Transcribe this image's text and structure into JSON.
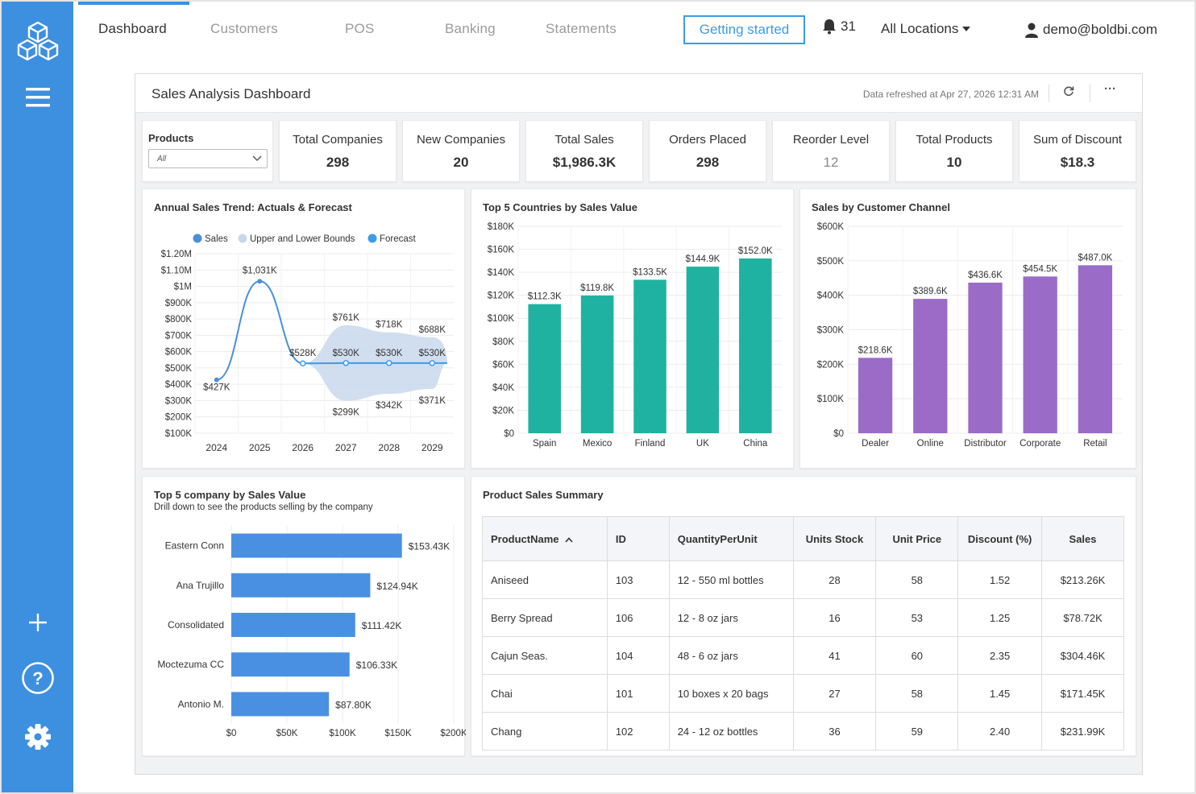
{
  "nav": {
    "tabs": [
      "Dashboard",
      "Customers",
      "POS",
      "Banking",
      "Statements"
    ],
    "getting_started": "Getting started",
    "notifications": "31",
    "location": "All Locations",
    "user": "demo@boldbi.com"
  },
  "sidebar": {
    "icons": [
      "logo-cube-icon",
      "menu-icon",
      "plus-icon",
      "help-icon",
      "settings-icon"
    ]
  },
  "dashboard": {
    "title": "Sales Analysis Dashboard",
    "refreshed": "Data refreshed at Apr 27, 2026 12:31 AM"
  },
  "filter": {
    "label": "Products",
    "value": "All"
  },
  "kpis": [
    {
      "label": "Total Companies",
      "value": "298"
    },
    {
      "label": "New Companies",
      "value": "20"
    },
    {
      "label": "Total Sales",
      "value": "$1,986.3K"
    },
    {
      "label": "Orders Placed",
      "value": "298"
    },
    {
      "label": "Reorder Level",
      "value": "12"
    },
    {
      "label": "Total Products",
      "value": "10"
    },
    {
      "label": "Sum of Discount",
      "value": "$18.3"
    }
  ],
  "chart_data": [
    {
      "type": "line",
      "title": "Annual Sales Trend: Actuals & Forecast",
      "legend": [
        "Sales",
        "Upper and Lower Bounds",
        "Forecast"
      ],
      "legend_position": "top",
      "x": [
        "2024",
        "2025",
        "2026",
        "2027",
        "2028",
        "2029"
      ],
      "series": [
        {
          "name": "Sales",
          "x": [
            "2024",
            "2025",
            "2026"
          ],
          "values": [
            427,
            1031,
            528
          ],
          "labels": [
            "$427K",
            "$1,031K",
            "$528K"
          ]
        },
        {
          "name": "Forecast",
          "x": [
            "2026",
            "2027",
            "2028",
            "2029"
          ],
          "values": [
            528,
            530,
            530,
            530
          ],
          "labels": [
            "$528K",
            "$530K",
            "$530K",
            "$530K"
          ]
        },
        {
          "name": "Upper and Lower Bounds",
          "x": [
            "2027",
            "2028",
            "2029"
          ],
          "upper": [
            761,
            718,
            688
          ],
          "lower": [
            299,
            342,
            371
          ],
          "upper_labels": [
            "$761K",
            "$718K",
            "$688K"
          ],
          "lower_labels": [
            "$299K",
            "$342K",
            "$371K"
          ]
        }
      ],
      "ytick_labels": [
        "$100K",
        "$200K",
        "$300K",
        "$400K",
        "$500K",
        "$600K",
        "$700K",
        "$800K",
        "$900K",
        "$1M",
        "$1.10M",
        "$1.20M"
      ],
      "ylim": [
        100,
        1200
      ],
      "colors": {
        "sales": "#4a90d9",
        "bounds": "#c8d8ec",
        "forecast": "#3d9be9"
      }
    },
    {
      "type": "bar",
      "title": "Top 5 Countries by Sales Value",
      "categories": [
        "Spain",
        "Mexico",
        "Finland",
        "UK",
        "China"
      ],
      "values": [
        112.3,
        119.8,
        133.5,
        144.9,
        152.0
      ],
      "labels": [
        "$112.3K",
        "$119.8K",
        "$133.5K",
        "$144.9K",
        "$152.0K"
      ],
      "ytick_labels": [
        "$0",
        "$20K",
        "$40K",
        "$60K",
        "$80K",
        "$100K",
        "$120K",
        "$140K",
        "$160K",
        "$180K"
      ],
      "ylim": [
        0,
        180
      ],
      "color": "#20b2a0"
    },
    {
      "type": "bar",
      "title": "Sales by Customer Channel",
      "categories": [
        "Dealer",
        "Online",
        "Distributor",
        "Corporate",
        "Retail"
      ],
      "values": [
        218.6,
        389.6,
        436.6,
        454.5,
        487.0
      ],
      "labels": [
        "$218.6K",
        "$389.6K",
        "$436.6K",
        "$454.5K",
        "$487.0K"
      ],
      "ytick_labels": [
        "$0",
        "$100K",
        "$200K",
        "$300K",
        "$400K",
        "$500K",
        "$600K"
      ],
      "ylim": [
        0,
        600
      ],
      "color": "#9b6bc8"
    },
    {
      "type": "bar",
      "orientation": "horizontal",
      "title": "Top 5 company by Sales Value",
      "subtitle": "Drill down to see the products selling by the company",
      "categories": [
        "Eastern Conn",
        "Ana Trujillo",
        "Consolidated",
        "Moctezuma CC",
        "Antonio M."
      ],
      "values": [
        153.43,
        124.94,
        111.42,
        106.33,
        87.8
      ],
      "labels": [
        "$153.43K",
        "$124.94K",
        "$111.42K",
        "$106.33K",
        "$87.80K"
      ],
      "xtick_labels": [
        "$0",
        "$50K",
        "$100K",
        "$150K",
        "$200K"
      ],
      "xlim": [
        0,
        200
      ],
      "color": "#4a90e2"
    },
    {
      "type": "table",
      "title": "Product Sales Summary",
      "columns": [
        "ProductName",
        "ID",
        "QuantityPerUnit",
        "Units Stock",
        "Unit Price",
        "Discount (%)",
        "Sales"
      ],
      "sort_indicator": "ProductName ascending",
      "rows": [
        [
          "Aniseed",
          "103",
          "12 - 550 ml bottles",
          "28",
          "58",
          "1.52",
          "$213.26K"
        ],
        [
          "Berry Spread",
          "106",
          "12 - 8 oz jars",
          "16",
          "53",
          "1.25",
          "$78.72K"
        ],
        [
          "Cajun Seas.",
          "104",
          "48 - 6 oz jars",
          "41",
          "60",
          "2.35",
          "$304.46K"
        ],
        [
          "Chai",
          "101",
          "10 boxes x 20 bags",
          "27",
          "58",
          "1.45",
          "$171.45K"
        ],
        [
          "Chang",
          "102",
          "24 - 12 oz bottles",
          "36",
          "59",
          "2.40",
          "$231.99K"
        ]
      ]
    }
  ]
}
